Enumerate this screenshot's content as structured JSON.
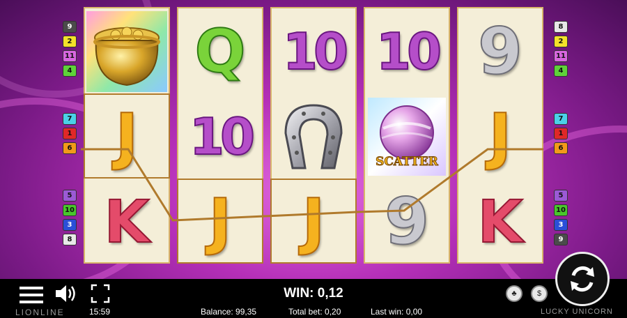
{
  "game": {
    "provider": "LIONLINE",
    "title": "LUCKY UNICORN"
  },
  "paylines_left": [
    "9",
    "2",
    "11",
    "4",
    "7",
    "1",
    "6",
    "5",
    "10",
    "3",
    "8"
  ],
  "paylines_right": [
    "8",
    "2",
    "11",
    "4",
    "7",
    "1",
    "6",
    "5",
    "10",
    "3",
    "9"
  ],
  "payline_colors": {
    "9": "#4b4b4b",
    "2": "#f3e12a",
    "11": "#d866e0",
    "4": "#5fd23a",
    "7": "#4bd0e8",
    "1": "#e02828",
    "6": "#f29a1a",
    "5": "#9b5ad6",
    "10": "#49c62c",
    "3": "#2a4fd8",
    "8": "#e8e8e8"
  },
  "reels": [
    [
      "pot-of-gold",
      "J",
      "K"
    ],
    [
      "Q",
      "10",
      "J"
    ],
    [
      "10",
      "horseshoe",
      "J"
    ],
    [
      "10",
      "scatter",
      "9"
    ],
    [
      "9",
      "J",
      "K"
    ]
  ],
  "scatter_label": "SCATTER",
  "hud": {
    "win_label": "WIN: 0,12",
    "clock": "15:59",
    "balance": "Balance: 99,35",
    "total_bet": "Total bet: 0,20",
    "last_win": "Last win: 0,00"
  },
  "colors": {
    "background": "#b52fb8",
    "reel_bg": "#f4eed8",
    "win_line": "#b07a2c"
  }
}
